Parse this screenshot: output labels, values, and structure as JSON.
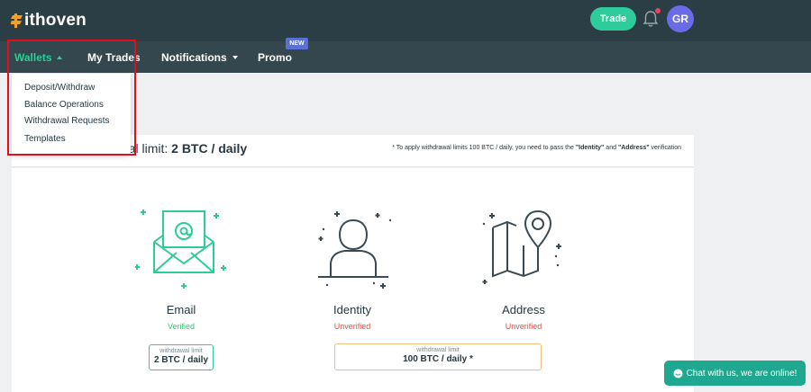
{
  "brand": {
    "name": "ithoven"
  },
  "topbar": {
    "trade_label": "Trade",
    "avatar_initials": "GR"
  },
  "nav": {
    "wallets": "Wallets",
    "my_trades": "My Trades",
    "notifications": "Notifications",
    "promo": "Promo",
    "promo_badge": "NEW"
  },
  "wallets_menu": {
    "items": [
      "Deposit/Withdraw",
      "Balance Operations",
      "Withdrawal Requests",
      "Templates"
    ]
  },
  "limits": {
    "title_prefix": "Available withdrawal limit: ",
    "title_value": "2 BTC / daily",
    "note_prefix": "* To apply withdrawal limits 100 BTC / daily, you need to pass the ",
    "note_identity": "\"Identity\"",
    "note_and": " and ",
    "note_address": "\"Address\"",
    "note_suffix": " verification"
  },
  "verification": [
    {
      "label": "Email",
      "status": "Verified"
    },
    {
      "label": "Identity",
      "status": "Unverified"
    },
    {
      "label": "Address",
      "status": "Unverified"
    }
  ],
  "limit_boxes": [
    {
      "caption": "withdrawal limit",
      "value": "2 BTC / daily"
    },
    {
      "caption": "withdrawal limit",
      "value": "100 BTC / daily *"
    }
  ],
  "chat": {
    "label": "Chat with us, we are online!"
  },
  "colors": {
    "topbar": "#2b3d45",
    "navbar": "#34474f",
    "accent_green": "#2ecc9a",
    "verified": "#2ecc71",
    "unverified": "#e74c3c",
    "badge": "#5b70d6",
    "avatar": "#6a6be6",
    "highlight": "#e0101a",
    "chat": "#1fa890"
  }
}
